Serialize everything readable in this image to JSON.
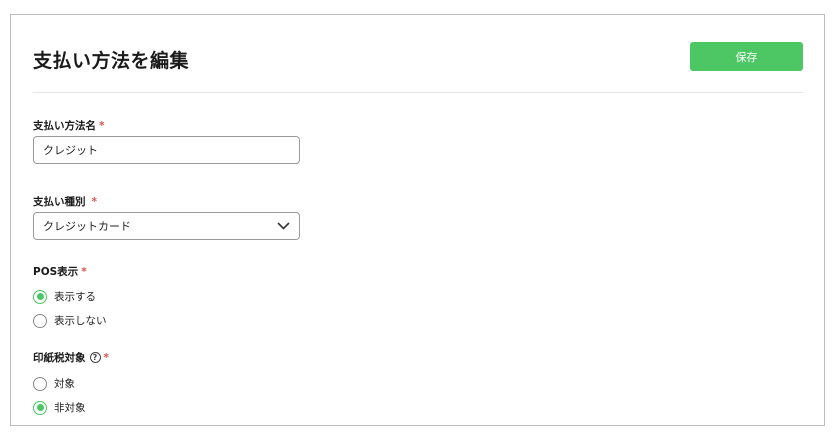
{
  "header": {
    "title": "支払い方法を編集",
    "save_label": "保存"
  },
  "form": {
    "name_field": {
      "label": "支払い方法名",
      "required_mark": "*",
      "value": "クレジット"
    },
    "type_field": {
      "label": "支払い種別",
      "required_mark": "*",
      "selected": "クレジットカード"
    },
    "pos_display": {
      "label": "POS表示",
      "required_mark": "*",
      "options": [
        {
          "label": "表示する",
          "checked": true
        },
        {
          "label": "表示しない",
          "checked": false
        }
      ]
    },
    "stamp_tax": {
      "label": "印紙税対象",
      "help_icon": "?",
      "required_mark": "*",
      "options": [
        {
          "label": "対象",
          "checked": false
        },
        {
          "label": "非対象",
          "checked": true
        }
      ]
    }
  },
  "colors": {
    "accent": "#4cc764",
    "required": "#d9534f"
  }
}
